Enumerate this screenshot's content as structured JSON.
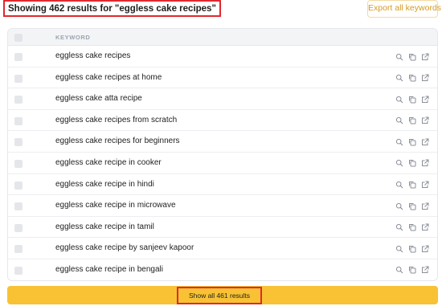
{
  "header": {
    "results_text": "Showing 462 results for \"eggless cake recipes\"",
    "export_label": "Export all keywords"
  },
  "table": {
    "column_header": "KEYWORD",
    "rows": [
      "eggless cake recipes",
      "eggless cake recipes at home",
      "eggless cake atta recipe",
      "eggless cake recipes from scratch",
      "eggless cake recipes for beginners",
      "eggless cake recipe in cooker",
      "eggless cake recipe in hindi",
      "eggless cake recipe in microwave",
      "eggless cake recipe in tamil",
      "eggless cake recipe by sanjeev kapoor",
      "eggless cake recipe in bengali"
    ],
    "row_icons": [
      "search-icon",
      "copy-icon",
      "external-link-icon"
    ]
  },
  "footer": {
    "show_all_label": "Show all 461 results"
  },
  "colors": {
    "accent_yellow": "#f8c234",
    "highlight_red": "#e0282f",
    "export_text": "#d49b1f"
  }
}
